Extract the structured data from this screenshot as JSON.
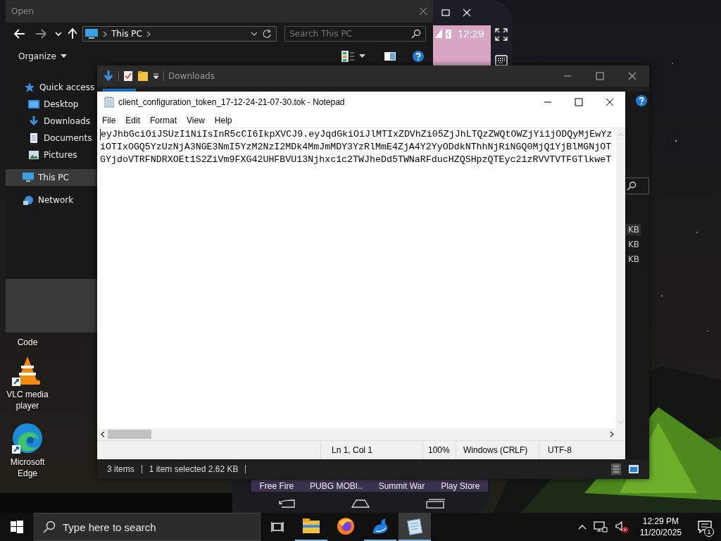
{
  "desktop": {
    "icons": [
      {
        "label": "Code",
        "kind": "partial"
      },
      {
        "label": "VLC media player",
        "kind": "vlc"
      },
      {
        "label": "Microsoft Edge",
        "kind": "edge"
      }
    ]
  },
  "phone_emulator": {
    "clock": "12:29",
    "apps": [
      "Free Fire",
      "PUBG MOBI..",
      "Summit War",
      "Play Store"
    ]
  },
  "open_dialog": {
    "title": "Open",
    "address": "This PC",
    "search": {
      "placeholder": "Search This PC"
    },
    "organize": "Organize",
    "sidebar": [
      {
        "label": "Quick access",
        "kind": "star",
        "selected": false,
        "children": [
          {
            "label": "Desktop",
            "kind": "desktop",
            "selected": false
          },
          {
            "label": "Downloads",
            "kind": "download",
            "selected": false
          },
          {
            "label": "Documents",
            "kind": "document",
            "selected": false
          },
          {
            "label": "Pictures",
            "kind": "picture",
            "selected": false
          }
        ]
      },
      {
        "label": "This PC",
        "kind": "pc",
        "selected": true
      },
      {
        "label": "Network",
        "kind": "network",
        "selected": false
      }
    ]
  },
  "explorer": {
    "title": "Downloads",
    "size_column": [
      "KB",
      "KB",
      "KB"
    ],
    "status": {
      "count": "3 items",
      "selection": "1 item selected  2.62 KB"
    }
  },
  "notepad": {
    "title": "client_configuration_token_17-12-24-21-07-30.tok - Notepad",
    "menu": [
      "File",
      "Edit",
      "Format",
      "View",
      "Help"
    ],
    "lines": [
      "eyJhbGciOiJSUzI1NiIsInR5cCI6IkpXVCJ9.eyJqdGkiOiJlMTIxZDVhZi05ZjJhLTQzZWQtOWZjYi1jODQyMjEwYz",
      "iOTIxOGQ5YzUzNjA3NGE3NmI5YzM2NzI2MDk4MmJmMDY3YzRlMmE4ZjA4Y2YyODdkNThhNjRiNGQ0MjQ1YjBlMGNjOT",
      "GYjdoVTRFNDRXOEt1S2ZiVm9FXG42UHFBVU13Njhxc1c2TWJheDd5TWNaRFducHZQSHpzQTEyc21zRVVTVTFGTlkweT"
    ],
    "status": {
      "position": "Ln 1, Col 1",
      "zoom": "100%",
      "line_endings": "Windows (CRLF)",
      "encoding": "UTF-8"
    }
  },
  "taskbar": {
    "search": {
      "placeholder": "Type here to search"
    },
    "apps": [
      {
        "kind": "explorer",
        "running": true,
        "selected": false
      },
      {
        "kind": "firefox",
        "running": false,
        "selected": false
      },
      {
        "kind": "bird",
        "running": true,
        "selected": false
      },
      {
        "kind": "notepad",
        "running": true,
        "selected": true
      }
    ],
    "time": "12:29 PM",
    "date": "11/20/2025",
    "notifications": "1"
  }
}
